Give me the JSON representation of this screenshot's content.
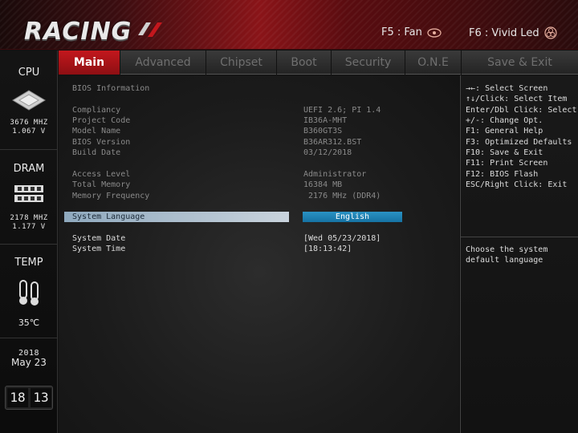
{
  "header": {
    "logo_text": "RACING",
    "f5_label": "F5 : Fan",
    "f6_label": "F6 : Vivid Led",
    "f5_icon": "fan-icon",
    "f6_icon": "led-icon"
  },
  "sidebar": {
    "cpu": {
      "label": "CPU",
      "freq": "3676 MHZ",
      "volt": "1.067 V"
    },
    "dram": {
      "label": "DRAM",
      "freq": "2178 MHZ",
      "volt": "1.177 V"
    },
    "temp": {
      "label": "TEMP",
      "value": "35℃"
    },
    "date": {
      "year": "2018",
      "month_day": "May 23"
    },
    "clock": {
      "hh": "18",
      "mm": "13"
    }
  },
  "tabs": [
    "Main",
    "Advanced",
    "Chipset",
    "Boot",
    "Security",
    "O.N.E",
    "Save & Exit"
  ],
  "active_tab": "Main",
  "main": {
    "section_title": "BIOS Information",
    "info": [
      {
        "label": "Compliancy",
        "value": "UEFI 2.6; PI 1.4"
      },
      {
        "label": "Project Code",
        "value": "IB36A-MHT"
      },
      {
        "label": "Model Name",
        "value": "B360GT3S"
      },
      {
        "label": "BIOS Version",
        "value": "B36AR312.BST"
      },
      {
        "label": "Build Date",
        "value": "03/12/2018"
      }
    ],
    "access": [
      {
        "label": "Access Level",
        "value": "Administrator"
      },
      {
        "label": "Total Memory",
        "value": "16384 MB"
      },
      {
        "label": "Memory Frequency",
        "value": " 2176 MHz (DDR4)"
      }
    ],
    "language": {
      "label": "System Language",
      "value": "English"
    },
    "date": {
      "label": "System Date",
      "value": "[Wed 05/23/2018]"
    },
    "time": {
      "label": "System Time",
      "value": "[18:13:42]"
    }
  },
  "help": {
    "keys": [
      "→←: Select Screen",
      "↑↓/Click: Select Item",
      "Enter/Dbl Click: Select",
      "+/-: Change Opt.",
      "F1: General Help",
      "F3: Optimized Defaults",
      "F10: Save & Exit",
      "F11: Print Screen",
      "F12: BIOS Flash",
      "ESC/Right Click: Exit"
    ],
    "description": [
      "Choose the system",
      "default language"
    ]
  },
  "colors": {
    "accent_red": "#c3171d",
    "select_blue": "#1e84b8"
  }
}
